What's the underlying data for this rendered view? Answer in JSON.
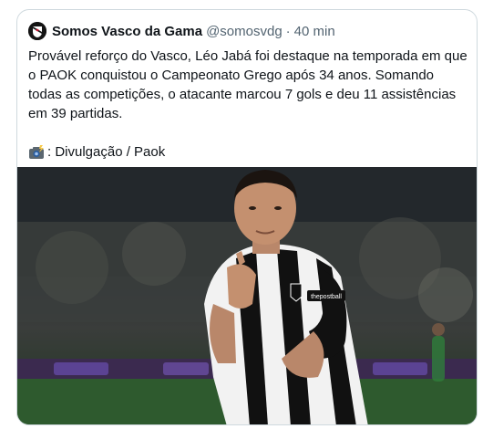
{
  "tweet": {
    "author": {
      "name": "Somos Vasco da Gama",
      "handle": "@somosvdg",
      "separator": "·",
      "time": "40 min",
      "avatar_icon": "vasco-crest-icon"
    },
    "text": "Provável reforço do Vasco, Léo Jabá foi destaque na temporada em que o PAOK conquistou o Campeonato Grego após 34 anos. Somando todas as competições, o atacante marcou 7 gols e deu 11 assistências em 39 partidas.",
    "credit": {
      "icon": "camera-flash-icon",
      "text": ": Divulgação / Paok"
    },
    "photo": {
      "jersey_sponsor": "thepostball",
      "colors": {
        "pitch": "#2e5a2e",
        "jersey_black": "#111111",
        "jersey_white": "#f2f2f2",
        "skin": "#b9876a"
      }
    }
  }
}
